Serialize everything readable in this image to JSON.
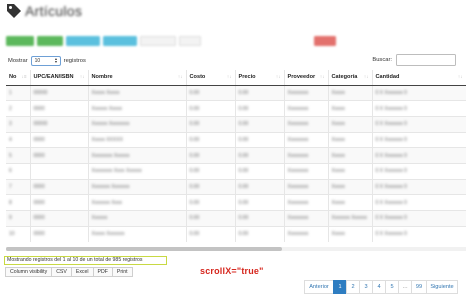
{
  "header": {
    "title": "Artículos",
    "title_icon": "tag-icon"
  },
  "toolbar": {
    "buttons": [
      {
        "color": "#5cb85c"
      },
      {
        "color": "#5cb85c"
      },
      {
        "color": "#5bc0de"
      },
      {
        "color": "#5bc0de"
      },
      {
        "color": "#f0f0f0"
      },
      {
        "color": "#f0f0f0"
      },
      {
        "color": "#d9534f"
      }
    ]
  },
  "length": {
    "label_before": "Mostrar",
    "selected": "10",
    "label_after": "registros"
  },
  "search": {
    "label": "Buscar:",
    "value": ""
  },
  "table": {
    "columns": [
      "No",
      "UPC/EAN/ISBN",
      "Nombre",
      "Costo",
      "Precio",
      "Proveedor",
      "Categoría",
      "Cantidad"
    ],
    "rows": [
      [
        "1",
        "00000",
        "Xxxxx Xxxxx",
        "0.00",
        "0.00",
        "Xxxxxxxx",
        "Xxxxx",
        "0 X Xxxxxxx 0"
      ],
      [
        "2",
        "0000",
        "Xxxxxx Xxxxx",
        "0.00",
        "0.00",
        "Xxxxxxxx",
        "Xxxxx",
        "0 X Xxxxxxx 0"
      ],
      [
        "3",
        "00000",
        "Xxxxxx Xxxxxxxx",
        "0.00",
        "0.00",
        "Xxxxxxxx",
        "Xxxxx",
        "0 X Xxxxxxx 0"
      ],
      [
        "4",
        "0000",
        "Xxxxx XXXXX",
        "0.00",
        "0.00",
        "Xxxxxxxx",
        "Xxxxx",
        "0 X Xxxxxxx 0"
      ],
      [
        "5",
        "0000",
        "Xxxxxxxx Xxxxxx",
        "0.00",
        "0.00",
        "Xxxxxxxx",
        "Xxxxx",
        "0 X Xxxxxxx 0"
      ],
      [
        "6",
        "",
        "Xxxxxxxx Xxxx Xxxxxx",
        "0.00",
        "0.00",
        "Xxxxxxxx",
        "Xxxxx",
        "0 X Xxxxxxx 0"
      ],
      [
        "7",
        "0000",
        "Xxxxxxx Xxxxxxx",
        "0.00",
        "0.00",
        "Xxxxxxxx",
        "Xxxxx",
        "0 X Xxxxxxx 0"
      ],
      [
        "8",
        "0000",
        "Xxxxxxx Xxxx",
        "0.00",
        "0.00",
        "Xxxxxxxx",
        "Xxxxx",
        "0 X Xxxxxxx 0"
      ],
      [
        "9",
        "0000",
        "Xxxxxx",
        "0.00",
        "0.00",
        "Xxxxxxxx",
        "Xxxxxxx Xxxxxx",
        "0 X Xxxxxxx 0"
      ],
      [
        "10",
        "0000",
        "Xxxxx Xxxxxxx",
        "0.00",
        "0.00",
        "Xxxxxxxx",
        "Xxxxx",
        "0 X Xxxxxxx 0"
      ]
    ],
    "horizontal_scroll_fraction": 0.6
  },
  "info": {
    "text": "Mostrando registros del 1 al 10 de un total de 985 registros",
    "border_color": "#c8d943"
  },
  "export_buttons": [
    "Column visibility",
    "CSV",
    "Excel",
    "PDF",
    "Print"
  ],
  "annotation": {
    "text": "scrollX=\"true\"",
    "color": "#d6261d"
  },
  "pagination": {
    "prev": "Anterior",
    "pages": [
      "1",
      "2",
      "3",
      "4",
      "5",
      "…",
      "99"
    ],
    "active": "1",
    "next": "Siguiente",
    "active_color": "#2e7dc1"
  }
}
